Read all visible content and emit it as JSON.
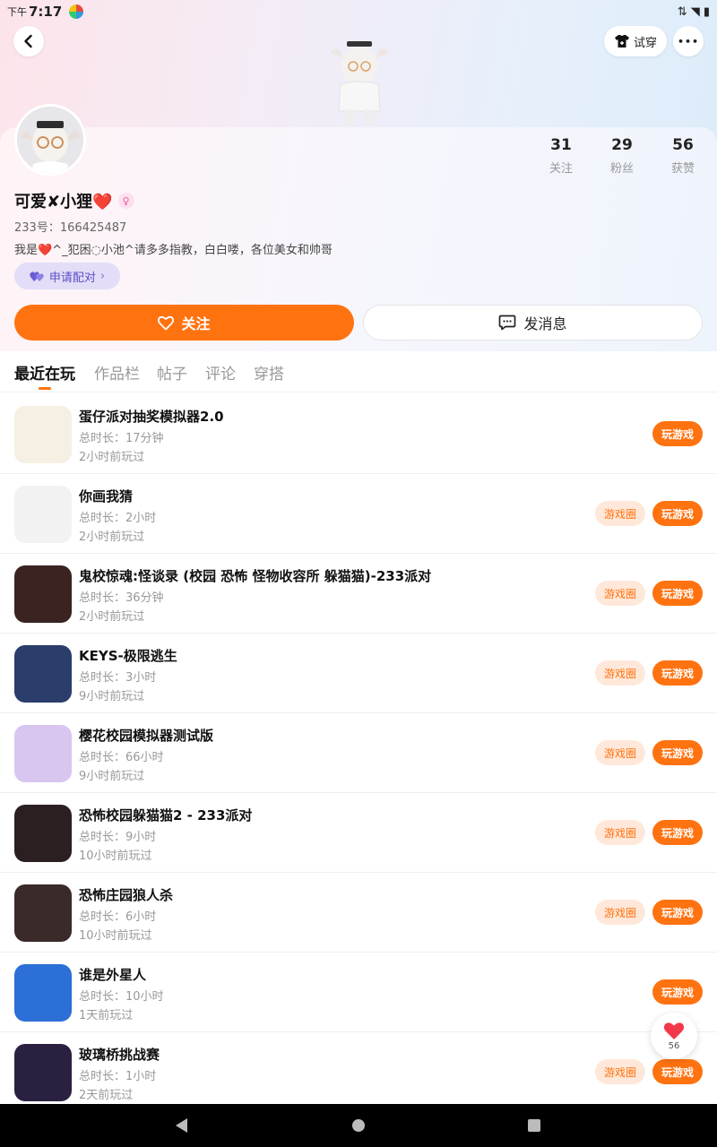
{
  "status_bar": {
    "time_prefix": "下午",
    "time": "7:17",
    "icons": "⇅ ◥ ▮"
  },
  "header": {
    "tryon_label": "试穿",
    "more_label": "•••"
  },
  "profile": {
    "stats": [
      {
        "num": "31",
        "label": "关注"
      },
      {
        "num": "29",
        "label": "粉丝"
      },
      {
        "num": "56",
        "label": "获赞"
      }
    ],
    "nickname": "可爱✘小狸❤️",
    "gender_symbol": "♀",
    "uid": "233号：166425487",
    "bio": "我是❤️^_犯困◌小池^请多多指教，白白喽，各位美女和帅哥",
    "pair_label": "申请配对",
    "follow_label": "关注",
    "message_label": "发消息"
  },
  "tabs": [
    "最近在玩",
    "作品栏",
    "帖子",
    "评论",
    "穿搭"
  ],
  "games": [
    {
      "title": "蛋仔派对抽奖模拟器2.0",
      "duration": "总时长：17分钟",
      "last_played": "2小时前玩过",
      "circle": false,
      "icon_color": "#f6f0e4"
    },
    {
      "title": "你画我猜",
      "duration": "总时长：2小时",
      "last_played": "2小时前玩过",
      "circle": true,
      "icon_color": "#f2f2f2"
    },
    {
      "title": "鬼校惊魂:怪谈录 (校园 恐怖 怪物收容所 躲猫猫)-233派对",
      "duration": "总时长：36分钟",
      "last_played": "2小时前玩过",
      "circle": true,
      "icon_color": "#3a2320"
    },
    {
      "title": "KEYS-极限逃生",
      "duration": "总时长：3小时",
      "last_played": "9小时前玩过",
      "circle": true,
      "icon_color": "#2a3d6b"
    },
    {
      "title": "樱花校园模拟器测试版",
      "duration": "总时长：66小时",
      "last_played": "9小时前玩过",
      "circle": true,
      "icon_color": "#d8c6f0"
    },
    {
      "title": "恐怖校园躲猫猫2 - 233派对",
      "duration": "总时长：9小时",
      "last_played": "10小时前玩过",
      "circle": true,
      "icon_color": "#2b1f22"
    },
    {
      "title": "恐怖庄园狼人杀",
      "duration": "总时长：6小时",
      "last_played": "10小时前玩过",
      "circle": true,
      "icon_color": "#3b2a2a"
    },
    {
      "title": "谁是外星人",
      "duration": "总时长：10小时",
      "last_played": "1天前玩过",
      "circle": false,
      "icon_color": "#2c6fd6"
    },
    {
      "title": "玻璃桥挑战赛",
      "duration": "总时长：1小时",
      "last_played": "2天前玩过",
      "circle": true,
      "icon_color": "#2a2140"
    }
  ],
  "buttons": {
    "circle_label": "游戏圈",
    "play_label": "玩游戏"
  },
  "float_like": {
    "count": "56"
  }
}
